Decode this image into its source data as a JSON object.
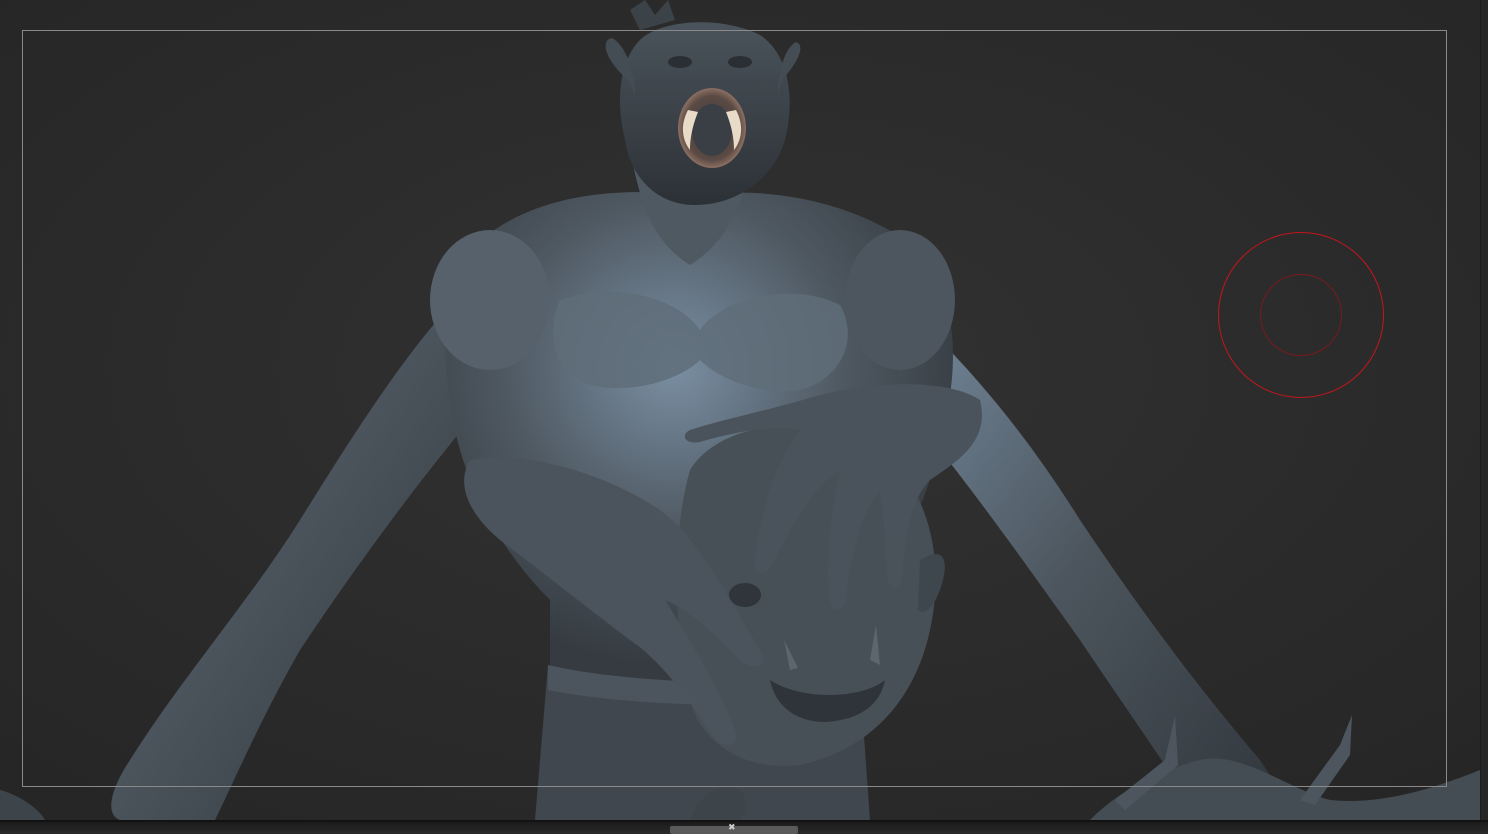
{
  "app": {
    "canvas_background": "#2c2c2c",
    "frame_color": "#8a8a8a"
  },
  "viewport": {
    "model": "sculpted-creature-model",
    "material_color": "#4f5860",
    "highlight_color": "#7e93a8"
  },
  "brush": {
    "outer_color": "#c4161c",
    "inner_color": "#7a1a1e"
  },
  "footer": {
    "handle_mark": "✖"
  }
}
